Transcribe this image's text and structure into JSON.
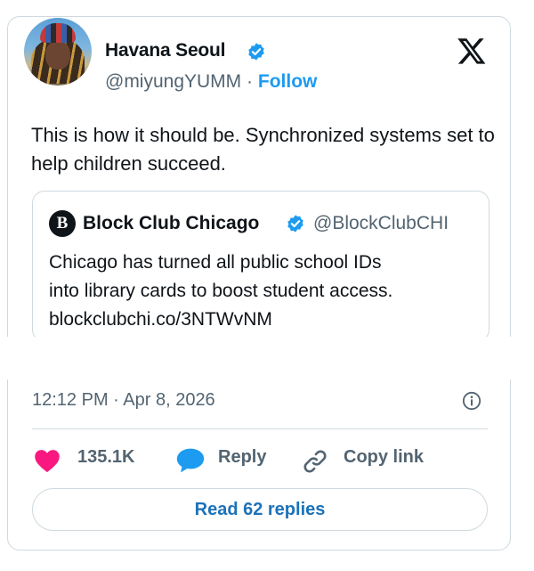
{
  "author": {
    "name": "Havana Seoul",
    "handle": "@miyungYUMM",
    "separator": "·",
    "follow_label": "Follow"
  },
  "tweet": {
    "text": "This is how it should be. Synchronized systems set to help children succeed."
  },
  "quoted_tweet": {
    "logo_letter": "B",
    "name": "Block Club Chicago",
    "handle": "@BlockClubCHI",
    "text_line1": "Chicago has turned all public school IDs",
    "text_line2": "into library cards to boost student access.",
    "text_line3": "blockclubchi.co/3NTWvNM"
  },
  "timestamp": "12:12 PM · Apr 8, 2026",
  "actions": {
    "like_count": "135.1K",
    "reply_label": "Reply",
    "copy_link_label": "Copy link"
  },
  "read_replies_label": "Read 62 replies",
  "colors": {
    "verified": "#1d9bf0",
    "like": "#f91880",
    "reply": "#1d9bf0",
    "link": "#1d72b8",
    "border": "#cfd9de",
    "muted": "#536471"
  },
  "icons": [
    "verified-badge-icon",
    "x-logo-icon",
    "info-icon",
    "heart-icon",
    "reply-bubble-icon",
    "link-icon"
  ]
}
